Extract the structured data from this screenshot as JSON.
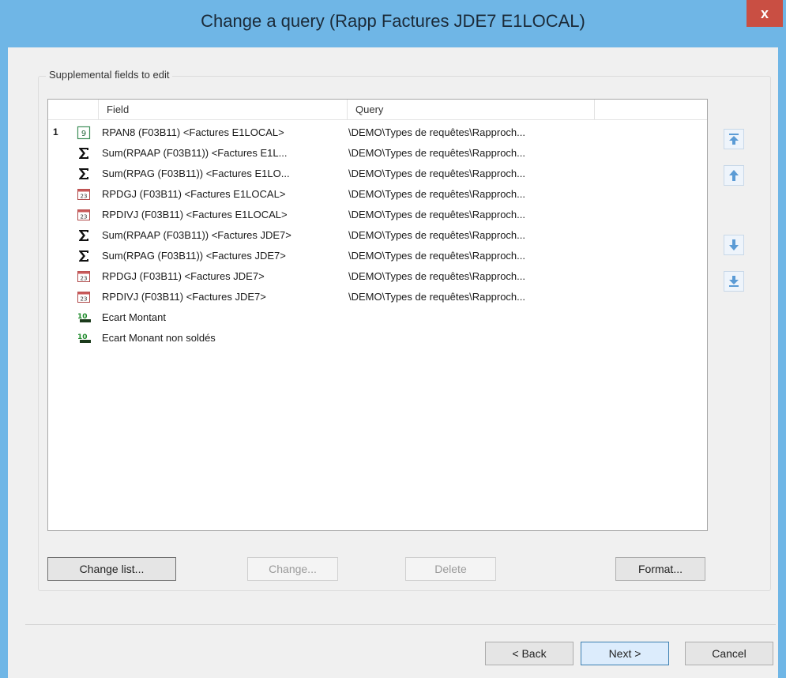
{
  "window": {
    "title": "Change a query (Rapp Factures JDE7 E1LOCAL)",
    "close_glyph": "x"
  },
  "group": {
    "label": "Supplemental fields to edit"
  },
  "columns": {
    "field": "Field",
    "query": "Query"
  },
  "rows": [
    {
      "num": "1",
      "icon": "number-field-icon",
      "field": "RPAN8 (F03B11) <Factures E1LOCAL>",
      "query": "\\DEMO\\Types de requêtes\\Rapproch..."
    },
    {
      "num": "",
      "icon": "sum-icon",
      "field": "Sum(RPAAP (F03B11)) <Factures E1L...",
      "query": "\\DEMO\\Types de requêtes\\Rapproch..."
    },
    {
      "num": "",
      "icon": "sum-icon",
      "field": "Sum(RPAG (F03B11)) <Factures E1LO...",
      "query": "\\DEMO\\Types de requêtes\\Rapproch..."
    },
    {
      "num": "",
      "icon": "date-field-icon",
      "field": "RPDGJ (F03B11) <Factures E1LOCAL>",
      "query": "\\DEMO\\Types de requêtes\\Rapproch..."
    },
    {
      "num": "",
      "icon": "date-field-icon",
      "field": "RPDIVJ (F03B11) <Factures E1LOCAL>",
      "query": "\\DEMO\\Types de requêtes\\Rapproch..."
    },
    {
      "num": "",
      "icon": "sum-icon",
      "field": "Sum(RPAAP (F03B11)) <Factures JDE7>",
      "query": "\\DEMO\\Types de requêtes\\Rapproch..."
    },
    {
      "num": "",
      "icon": "sum-icon",
      "field": "Sum(RPAG (F03B11)) <Factures JDE7>",
      "query": "\\DEMO\\Types de requêtes\\Rapproch..."
    },
    {
      "num": "",
      "icon": "date-field-icon",
      "field": "RPDGJ (F03B11) <Factures JDE7>",
      "query": "\\DEMO\\Types de requêtes\\Rapproch..."
    },
    {
      "num": "",
      "icon": "date-field-icon",
      "field": "RPDIVJ (F03B11) <Factures JDE7>",
      "query": "\\DEMO\\Types de requêtes\\Rapproch..."
    },
    {
      "num": "",
      "icon": "calculated-field-icon",
      "field": "Ecart Montant",
      "query": ""
    },
    {
      "num": "",
      "icon": "calculated-field-icon",
      "field": "Ecart Monant non soldés",
      "query": ""
    }
  ],
  "buttons": {
    "change_list": "Change list...",
    "change": "Change...",
    "delete": "Delete",
    "format": "Format...",
    "back": "< Back",
    "next": "Next >",
    "cancel": "Cancel"
  },
  "colors": {
    "titlebar": "#6fb6e6",
    "close": "#c94f43",
    "move_arrow": "#5b9bd5"
  }
}
